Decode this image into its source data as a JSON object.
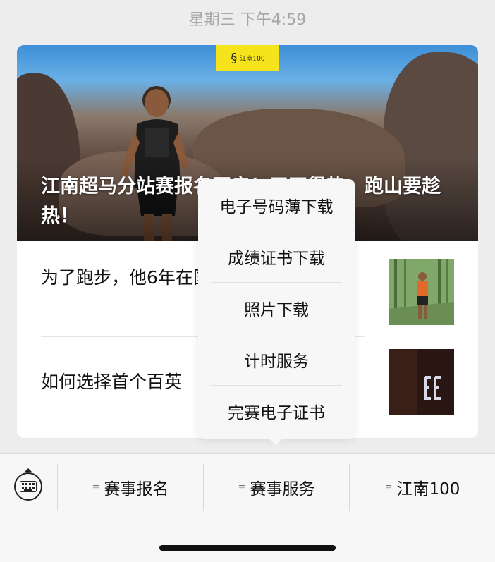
{
  "timestamp": "星期三 下午4:59",
  "hero": {
    "logo_text": "江南100",
    "title": "江南超马分站赛报名开启！天正很热，跑山要趁热！"
  },
  "articles": [
    {
      "title": "为了跑步，他6年在国“跑痴”！"
    },
    {
      "title": "如何选择首个百英"
    }
  ],
  "popup": {
    "items": [
      {
        "label": "电子号码薄下载"
      },
      {
        "label": "成绩证书下载"
      },
      {
        "label": "照片下载"
      },
      {
        "label": "计时服务"
      },
      {
        "label": "完赛电子证书"
      }
    ]
  },
  "menu": {
    "keyboard_icon": "keyboard-icon",
    "items": [
      {
        "label": "赛事报名",
        "icon": "menu-list-icon"
      },
      {
        "label": "赛事服务",
        "icon": "menu-list-icon"
      },
      {
        "label": "江南100",
        "icon": "menu-list-icon"
      }
    ]
  },
  "colors": {
    "background": "#ededed",
    "logo_yellow": "#f5e31c",
    "popup_bg": "#f7f7f7"
  }
}
